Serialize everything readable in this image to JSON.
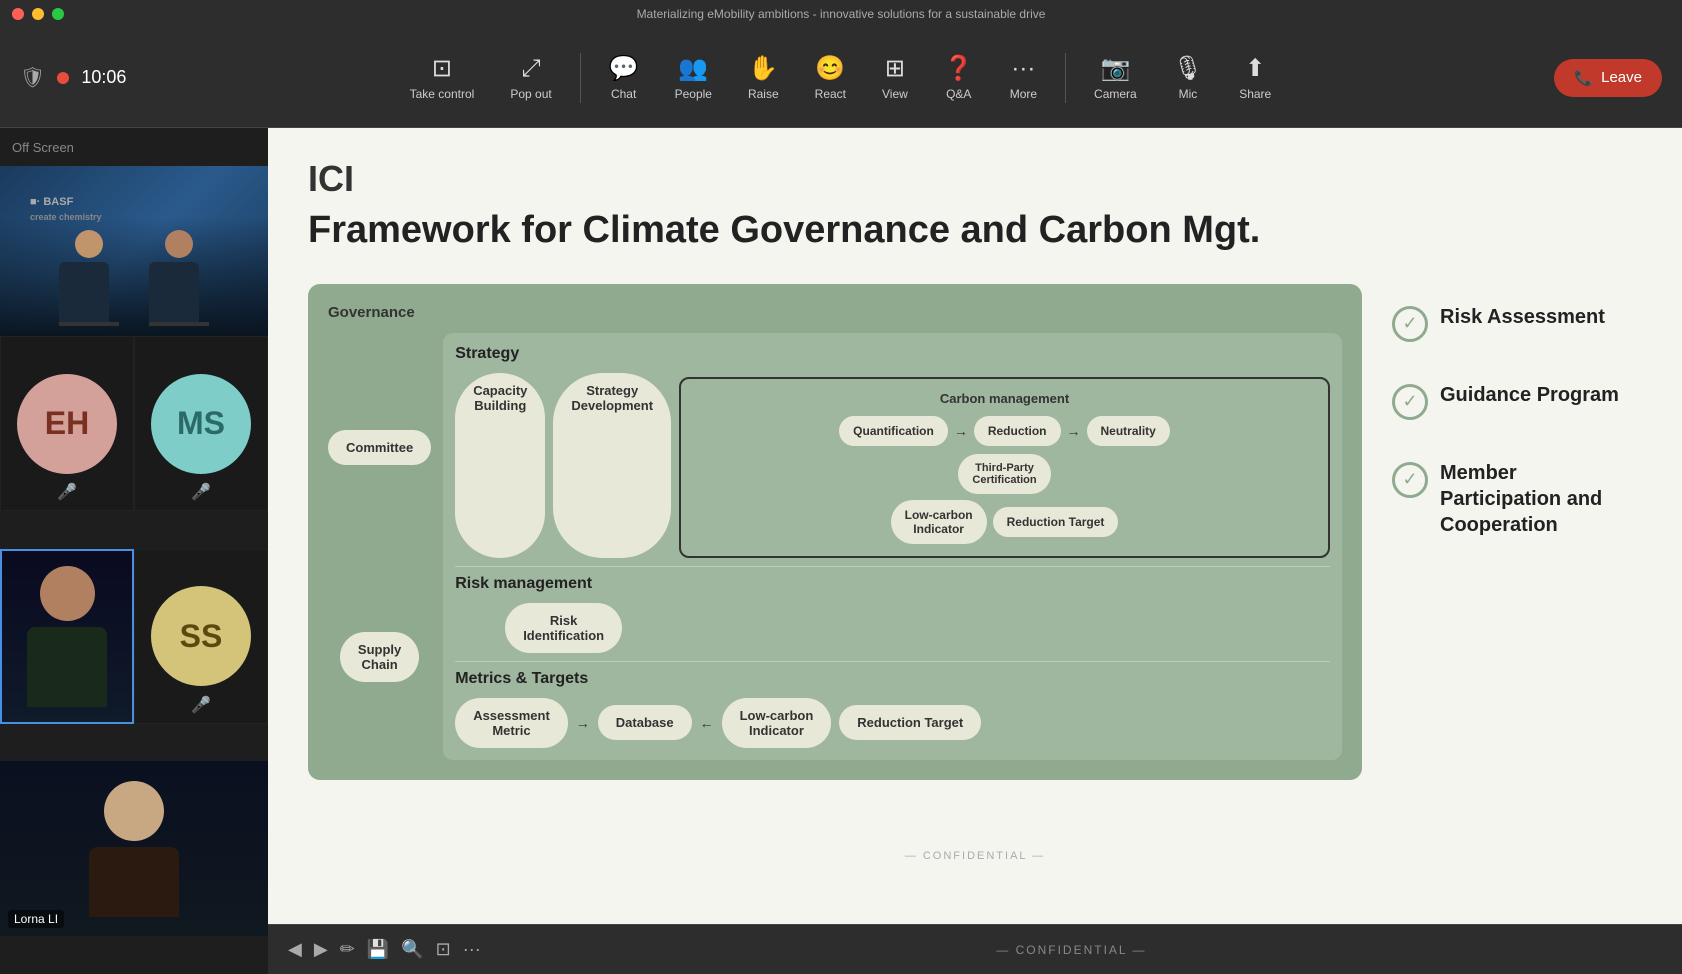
{
  "window": {
    "title": "Materializing eMobility ambitions - innovative solutions for a sustainable drive"
  },
  "toolbar": {
    "time": "10:06",
    "buttons": [
      {
        "id": "take-control",
        "label": "Take control",
        "icon": "⊡"
      },
      {
        "id": "pop-out",
        "label": "Pop out",
        "icon": "⤢"
      },
      {
        "id": "chat",
        "label": "Chat",
        "icon": "💬"
      },
      {
        "id": "people",
        "label": "People",
        "icon": "👥"
      },
      {
        "id": "raise",
        "label": "Raise",
        "icon": "✋"
      },
      {
        "id": "react",
        "label": "React",
        "icon": "😊"
      },
      {
        "id": "view",
        "label": "View",
        "icon": "⊞"
      },
      {
        "id": "qa",
        "label": "Q&A",
        "icon": "❓"
      },
      {
        "id": "more",
        "label": "More",
        "icon": "···"
      },
      {
        "id": "camera",
        "label": "Camera",
        "icon": "📷"
      },
      {
        "id": "mic",
        "label": "Mic",
        "icon": "🎤"
      },
      {
        "id": "share",
        "label": "Share",
        "icon": "⬆"
      }
    ],
    "leave_label": "Leave"
  },
  "sidebar": {
    "header": "Off Screen",
    "participants": [
      {
        "id": "EH",
        "initials": "EH",
        "color": "#e8c4b8",
        "text_color": "#8b4513",
        "muted": true
      },
      {
        "id": "MS",
        "initials": "MS",
        "color": "#7ecdc8",
        "text_color": "#2a6a68",
        "muted": true
      }
    ],
    "video_person": {
      "name": "Lorna LI"
    }
  },
  "slide": {
    "logo": "ICI",
    "title": "Framework for Climate Governance and Carbon Mgt.",
    "diagram": {
      "governance_label": "Governance",
      "strategy_label": "Strategy",
      "carbon_management_label": "Carbon management",
      "risk_management_label": "Risk management",
      "metrics_targets_label": "Metrics & Targets",
      "nodes": {
        "committee": "Committee",
        "supply_chain": "Supply Chain",
        "capacity_building": "Capacity Building",
        "strategy_development": "Strategy Development",
        "risk_identification": "Risk Identification",
        "quantification": "Quantification",
        "reduction": "Reduction",
        "neutrality": "Neutrality",
        "third_party_certification": "Third-Party Certification",
        "assessment_metric": "Assessment Metric",
        "database": "Database",
        "low_carbon_indicator": "Low-carbon Indicator",
        "reduction_target": "Reduction Target"
      }
    },
    "right_items": [
      {
        "id": "risk-assessment",
        "label": "Risk Assessment"
      },
      {
        "id": "guidance-program",
        "label": "Guidance Program"
      },
      {
        "id": "member-participation",
        "label": "Member Participation and Cooperation"
      }
    ],
    "confidential": "— CONFIDENTIAL —"
  }
}
